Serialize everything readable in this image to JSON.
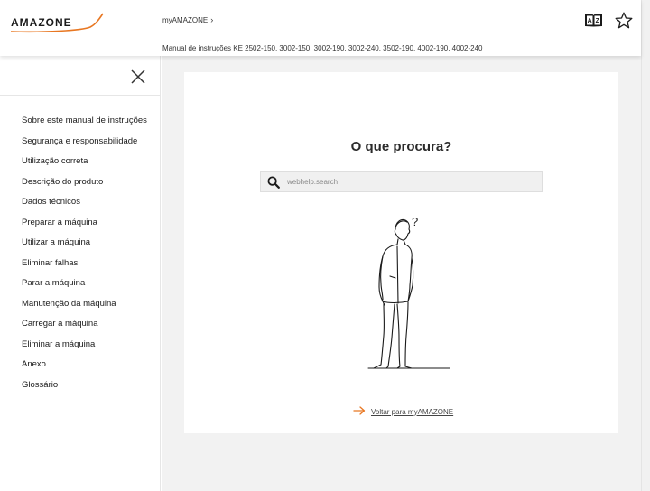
{
  "header": {
    "logo_text": "AMAZONE",
    "breadcrumb": {
      "root": "myAMAZONE",
      "separator": "›"
    },
    "manual_title": "Manual de instruções KE 2502-150, 3002-150, 3002-190, 3002-240, 3502-190, 4002-190, 4002-240",
    "icons": [
      "dictionary-icon",
      "favorite-star-icon"
    ],
    "brand_color": "#e87722"
  },
  "sidebar": {
    "items": [
      {
        "label": "Sobre este manual de instruções"
      },
      {
        "label": "Segurança e responsabilidade"
      },
      {
        "label": "Utilização correta"
      },
      {
        "label": "Descrição do produto"
      },
      {
        "label": "Dados técnicos"
      },
      {
        "label": "Preparar a máquina"
      },
      {
        "label": "Utilizar a máquina"
      },
      {
        "label": "Eliminar falhas"
      },
      {
        "label": "Parar a máquina"
      },
      {
        "label": "Manutenção da máquina"
      },
      {
        "label": "Carregar a máquina"
      },
      {
        "label": "Eliminar a máquina"
      },
      {
        "label": "Anexo"
      },
      {
        "label": "Glossário"
      }
    ]
  },
  "main": {
    "title": "O que procura?",
    "search": {
      "placeholder": "webhelp.search",
      "value": ""
    },
    "figure_icon": "confused-person-illustration",
    "question_mark": "?",
    "back_link": {
      "label": "Voltar para myAMAZONE",
      "icon": "arrow-right-icon"
    }
  }
}
